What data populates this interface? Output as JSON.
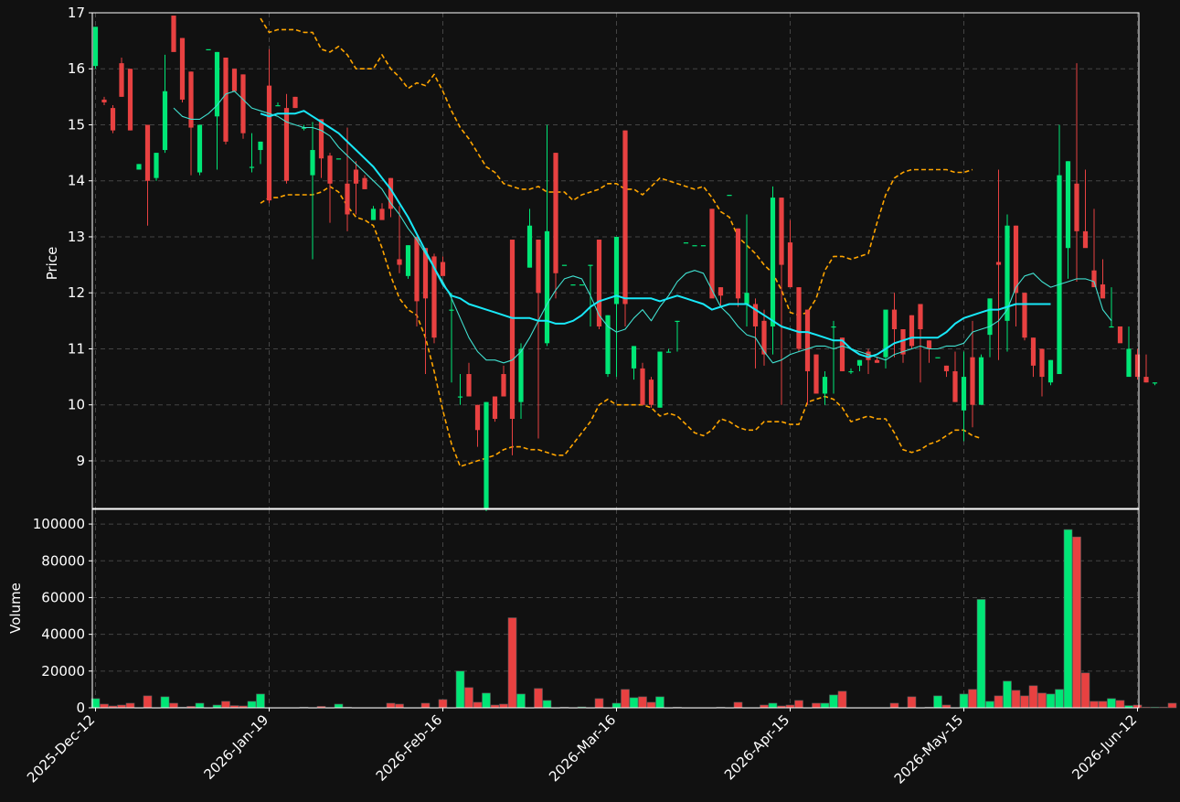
{
  "theme": {
    "background": "#111111",
    "up_color": "#00e676",
    "down_color": "#e84141",
    "ma_fast_color": "#40e0d0",
    "ma_slow_color": "#18e8f8",
    "band_color": "#ffa500",
    "grid_color": "#444444"
  },
  "chart_data": {
    "type": "candlestick",
    "price_panel": {
      "ylabel": "Price",
      "ylim": [
        8.15,
        17.0
      ],
      "yticks": [
        9,
        10,
        11,
        12,
        13,
        14,
        15,
        16,
        17
      ]
    },
    "volume_panel": {
      "ylabel": "Volume",
      "ylim": [
        0,
        108000
      ],
      "yticks": [
        0,
        20000,
        40000,
        60000,
        80000,
        100000
      ]
    },
    "x_tick_labels": [
      "2025-Dec-12",
      "2026-Jan-19",
      "2026-Feb-16",
      "2026-Mar-16",
      "2026-Apr-15",
      "2026-May-15",
      "2026-Jun-12"
    ],
    "x_tick_index": [
      0,
      20,
      40,
      60,
      80,
      100,
      120
    ],
    "grid": true,
    "series": [
      {
        "name": "ohlc",
        "o": [
          16.05,
          15.45,
          15.3,
          16.1,
          16.0,
          14.2,
          15.0,
          14.05,
          14.55,
          16.95,
          16.55,
          15.95,
          14.15,
          16.35,
          15.15,
          16.2,
          16.0,
          15.9,
          14.25,
          14.55,
          15.7,
          15.35,
          15.3,
          15.5,
          14.95,
          14.1,
          15.1,
          14.45,
          14.4,
          13.95,
          14.2,
          14.05,
          13.3,
          13.5,
          14.05,
          12.6,
          12.3,
          13.0,
          12.8,
          12.65,
          12.55,
          11.7,
          10.15,
          10.55,
          10.0,
          8.15,
          10.15,
          10.55,
          12.95,
          10.05,
          12.45,
          12.95,
          11.1,
          14.5,
          12.5,
          12.15,
          12.15,
          12.5,
          12.95,
          10.55,
          11.8,
          14.9,
          10.65,
          10.65,
          10.45,
          9.95,
          10.95,
          11.5,
          12.9,
          12.85,
          12.85,
          13.5,
          12.1,
          13.75,
          13.15,
          11.8,
          11.8,
          11.5,
          11.4,
          13.7,
          12.9,
          12.1,
          11.7,
          10.9,
          10.2,
          11.4,
          11.2,
          10.6,
          10.7,
          10.95,
          10.8,
          10.85,
          11.7,
          11.35,
          11.6,
          11.8,
          11.15,
          10.85,
          10.7,
          10.6,
          9.9,
          10.85,
          10.0,
          11.25,
          12.55,
          11.5,
          13.2,
          12.0,
          11.2,
          11.0,
          10.4,
          10.55,
          12.8,
          13.95,
          13.1,
          12.4,
          12.15,
          11.4,
          11.4,
          10.5,
          10.9,
          10.5,
          10.4
        ],
        "h": [
          16.75,
          15.5,
          15.35,
          16.2,
          16.0,
          14.3,
          15.0,
          14.5,
          16.25,
          16.95,
          16.55,
          15.95,
          15.0,
          16.35,
          16.3,
          16.2,
          16.0,
          15.9,
          14.85,
          14.7,
          16.35,
          15.4,
          15.55,
          15.5,
          15.0,
          15.05,
          15.1,
          14.5,
          14.4,
          14.95,
          14.35,
          14.1,
          13.55,
          13.6,
          14.05,
          13.55,
          12.85,
          13.0,
          12.8,
          12.7,
          12.65,
          12.0,
          10.55,
          10.75,
          10.0,
          10.05,
          10.15,
          10.7,
          12.95,
          11.1,
          13.5,
          12.95,
          15.0,
          14.5,
          12.5,
          12.15,
          12.15,
          12.5,
          12.95,
          11.6,
          13.0,
          14.9,
          11.05,
          10.75,
          10.5,
          10.95,
          11.0,
          11.5,
          12.9,
          12.85,
          12.85,
          13.5,
          12.1,
          13.75,
          13.15,
          13.4,
          11.9,
          11.7,
          13.9,
          13.7,
          13.3,
          12.1,
          11.7,
          10.9,
          10.6,
          11.5,
          11.2,
          10.65,
          10.8,
          11.0,
          10.85,
          11.25,
          12.0,
          11.35,
          11.6,
          11.8,
          11.15,
          10.85,
          10.7,
          10.95,
          10.95,
          11.5,
          10.9,
          11.45,
          14.2,
          13.4,
          13.2,
          12.0,
          11.2,
          11.0,
          10.8,
          15.0,
          14.35,
          16.1,
          14.2,
          13.5,
          12.6,
          12.1,
          11.4,
          11.4,
          11.0,
          10.9,
          10.4,
          10.55
        ],
        "l": [
          16.0,
          15.35,
          14.85,
          15.5,
          14.9,
          14.2,
          13.2,
          14.0,
          14.5,
          16.45,
          15.4,
          14.1,
          14.1,
          16.35,
          14.2,
          14.65,
          15.6,
          14.75,
          14.15,
          14.3,
          13.6,
          15.35,
          13.95,
          15.3,
          14.9,
          12.6,
          14.05,
          13.25,
          14.4,
          13.1,
          13.4,
          13.85,
          13.3,
          13.4,
          13.35,
          12.35,
          12.25,
          11.4,
          10.55,
          11.1,
          12.35,
          10.4,
          10.0,
          10.15,
          9.25,
          8.1,
          9.7,
          10.15,
          9.1,
          9.75,
          12.45,
          9.4,
          11.05,
          11.9,
          12.5,
          12.15,
          12.15,
          11.4,
          11.35,
          10.5,
          10.5,
          11.4,
          10.45,
          10.0,
          9.95,
          9.95,
          10.95,
          10.95,
          12.9,
          12.85,
          12.85,
          12.75,
          11.75,
          13.75,
          11.75,
          11.4,
          10.65,
          10.7,
          10.9,
          10.0,
          12.1,
          10.95,
          10.0,
          10.55,
          10.0,
          10.2,
          10.6,
          10.55,
          10.6,
          10.55,
          10.75,
          10.65,
          10.85,
          10.75,
          11.0,
          10.4,
          10.75,
          10.85,
          10.5,
          10.05,
          9.35,
          9.6,
          10.0,
          10.85,
          10.8,
          10.95,
          11.4,
          11.15,
          10.5,
          10.15,
          10.35,
          10.55,
          12.25,
          12.2,
          13.1,
          12.3,
          11.95,
          11.4,
          11.35,
          11.0,
          10.45,
          10.4,
          10.35,
          10.3
        ],
        "c": [
          16.75,
          15.4,
          14.9,
          15.5,
          14.9,
          14.3,
          14.0,
          14.5,
          15.6,
          16.3,
          15.45,
          14.95,
          15.0,
          16.35,
          16.3,
          14.7,
          15.6,
          14.85,
          14.25,
          14.7,
          13.65,
          15.35,
          14.0,
          15.3,
          14.95,
          14.55,
          14.4,
          13.95,
          14.4,
          13.4,
          13.95,
          13.85,
          13.5,
          13.3,
          13.5,
          12.5,
          12.85,
          11.85,
          11.9,
          11.2,
          12.3,
          11.7,
          10.15,
          10.15,
          9.55,
          10.05,
          9.75,
          10.15,
          9.75,
          11.0,
          13.2,
          12.0,
          13.1,
          12.35,
          12.5,
          12.15,
          12.15,
          12.5,
          11.4,
          11.6,
          13.0,
          11.8,
          11.05,
          10.0,
          10.0,
          10.95,
          10.95,
          11.5,
          12.9,
          12.85,
          12.85,
          11.9,
          11.95,
          13.75,
          11.9,
          12.0,
          11.4,
          10.9,
          13.7,
          12.5,
          12.1,
          11.0,
          10.6,
          10.2,
          10.5,
          11.4,
          10.6,
          10.6,
          10.8,
          10.8,
          10.75,
          11.7,
          11.35,
          10.9,
          11.05,
          11.35,
          11.0,
          10.85,
          10.6,
          10.05,
          10.5,
          10.0,
          10.85,
          11.9,
          12.5,
          13.2,
          12.0,
          11.2,
          10.7,
          10.5,
          10.8,
          14.1,
          14.35,
          13.1,
          12.8,
          12.1,
          11.9,
          11.4,
          11.1,
          11.0,
          10.5,
          10.4,
          10.4,
          10.5
        ]
      },
      {
        "name": "volume",
        "values": [
          5000,
          2000,
          1000,
          1500,
          2500,
          0,
          6500,
          0,
          6000,
          2500,
          400,
          800,
          2500,
          0,
          1500,
          3500,
          1200,
          1000,
          3500,
          7500,
          0,
          0,
          0,
          0,
          400,
          0,
          800,
          0,
          2000,
          400,
          0,
          0,
          0,
          0,
          2500,
          2000,
          0,
          0,
          2500,
          0,
          4500,
          0,
          20000,
          11000,
          3000,
          8000,
          1500,
          2000,
          49000,
          7500,
          0,
          10500,
          4000,
          0,
          400,
          0,
          500,
          0,
          5000,
          0,
          2500,
          10000,
          5500,
          6000,
          3000,
          6000,
          0,
          400,
          0,
          0,
          0,
          0,
          400,
          0,
          3000,
          0,
          0,
          1500,
          2500,
          1000,
          1500,
          4000,
          0,
          2500,
          2500,
          7000,
          9000,
          0,
          0,
          0,
          0,
          0,
          2500,
          0,
          6000,
          0,
          400,
          6500,
          1500,
          0,
          7500,
          10000,
          59000,
          3500,
          6500,
          14500,
          9500,
          6500,
          12000,
          8000,
          7500,
          10000,
          97000,
          93000,
          19000,
          3500,
          3500,
          5000,
          4000,
          1200,
          1500,
          400,
          400,
          400,
          2500
        ]
      },
      {
        "name": "ma_fast",
        "values": [
          null,
          null,
          null,
          null,
          null,
          null,
          null,
          null,
          null,
          15.3,
          15.15,
          15.1,
          15.1,
          15.2,
          15.35,
          15.55,
          15.6,
          15.45,
          15.3,
          15.25,
          15.2,
          15.15,
          15.05,
          15.0,
          14.95,
          14.95,
          14.9,
          14.8,
          14.6,
          14.45,
          14.3,
          14.15,
          14.0,
          13.85,
          13.6,
          13.4,
          13.15,
          12.95,
          12.7,
          12.45,
          12.2,
          11.9,
          11.55,
          11.2,
          10.95,
          10.8,
          10.8,
          10.75,
          10.8,
          10.95,
          11.2,
          11.5,
          11.8,
          12.05,
          12.25,
          12.3,
          12.25,
          11.95,
          11.6,
          11.4,
          11.3,
          11.35,
          11.55,
          11.7,
          11.5,
          11.75,
          11.95,
          12.2,
          12.35,
          12.4,
          12.35,
          12.05,
          11.75,
          11.6,
          11.4,
          11.25,
          11.2,
          10.95,
          10.75,
          10.8,
          10.9,
          10.95,
          11.0,
          11.05,
          11.05,
          11.0,
          11.05,
          11.0,
          10.95,
          10.9,
          10.85,
          10.8,
          10.9,
          10.95,
          11.0,
          11.05,
          11.0,
          11.0,
          11.05,
          11.05,
          11.1,
          11.3,
          11.35,
          11.4,
          11.5,
          11.7,
          12.1,
          12.3,
          12.35,
          12.2,
          12.1,
          12.15,
          12.2,
          12.25,
          12.25,
          12.2,
          11.7,
          11.5
        ]
      },
      {
        "name": "ma_slow",
        "values": [
          null,
          null,
          null,
          null,
          null,
          null,
          null,
          null,
          null,
          null,
          null,
          null,
          null,
          null,
          null,
          null,
          null,
          null,
          null,
          15.2,
          15.15,
          15.2,
          15.2,
          15.2,
          15.25,
          15.15,
          15.05,
          14.95,
          14.85,
          14.7,
          14.55,
          14.4,
          14.25,
          14.05,
          13.85,
          13.6,
          13.35,
          13.05,
          12.75,
          12.45,
          12.15,
          11.95,
          11.9,
          11.8,
          11.75,
          11.7,
          11.65,
          11.6,
          11.55,
          11.55,
          11.55,
          11.5,
          11.5,
          11.45,
          11.45,
          11.5,
          11.6,
          11.75,
          11.85,
          11.9,
          11.95,
          11.9,
          11.9,
          11.9,
          11.9,
          11.85,
          11.9,
          11.95,
          11.9,
          11.85,
          11.8,
          11.7,
          11.75,
          11.8,
          11.8,
          11.8,
          11.7,
          11.6,
          11.5,
          11.4,
          11.35,
          11.3,
          11.3,
          11.25,
          11.2,
          11.15,
          11.15,
          11.0,
          10.9,
          10.85,
          10.9,
          11.0,
          11.1,
          11.15,
          11.2,
          11.2,
          11.2,
          11.2,
          11.3,
          11.45,
          11.55,
          11.6,
          11.65,
          11.7,
          11.7,
          11.75,
          11.8,
          11.8,
          11.8,
          11.8,
          11.8
        ]
      },
      {
        "name": "band_upper",
        "values": [
          null,
          null,
          null,
          null,
          null,
          null,
          null,
          null,
          null,
          null,
          null,
          null,
          null,
          null,
          null,
          null,
          null,
          null,
          null,
          16.9,
          16.65,
          16.7,
          16.7,
          16.7,
          16.65,
          16.65,
          16.35,
          16.3,
          16.4,
          16.25,
          16.0,
          16.0,
          16.0,
          16.25,
          16.0,
          15.85,
          15.65,
          15.75,
          15.7,
          15.9,
          15.6,
          15.25,
          14.95,
          14.75,
          14.5,
          14.25,
          14.15,
          13.95,
          13.9,
          13.85,
          13.85,
          13.9,
          13.8,
          13.8,
          13.8,
          13.65,
          13.75,
          13.8,
          13.85,
          13.95,
          13.95,
          13.85,
          13.85,
          13.75,
          13.9,
          14.05,
          14.0,
          13.95,
          13.9,
          13.85,
          13.9,
          13.7,
          13.45,
          13.35,
          13.0,
          12.85,
          12.7,
          12.5,
          12.35,
          12.05,
          11.65,
          11.6,
          11.65,
          11.9,
          12.4,
          12.65,
          12.65,
          12.6,
          12.65,
          12.7,
          13.25,
          13.75,
          14.05,
          14.15,
          14.2,
          14.2,
          14.2,
          14.2,
          14.2,
          14.15,
          14.15,
          14.2
        ]
      },
      {
        "name": "band_lower",
        "values": [
          null,
          null,
          null,
          null,
          null,
          null,
          null,
          null,
          null,
          null,
          null,
          null,
          null,
          null,
          null,
          null,
          null,
          null,
          null,
          13.6,
          13.7,
          13.7,
          13.75,
          13.75,
          13.75,
          13.75,
          13.8,
          13.9,
          13.8,
          13.55,
          13.35,
          13.3,
          13.2,
          12.8,
          12.3,
          11.9,
          11.7,
          11.6,
          11.2,
          10.6,
          9.9,
          9.3,
          8.9,
          8.95,
          9.0,
          9.05,
          9.1,
          9.2,
          9.25,
          9.25,
          9.2,
          9.2,
          9.15,
          9.1,
          9.1,
          9.3,
          9.5,
          9.7,
          10.0,
          10.1,
          10.0,
          10.0,
          10.0,
          10.0,
          9.95,
          9.8,
          9.85,
          9.8,
          9.65,
          9.5,
          9.45,
          9.55,
          9.75,
          9.7,
          9.6,
          9.55,
          9.55,
          9.7,
          9.7,
          9.7,
          9.65,
          9.65,
          10.05,
          10.1,
          10.15,
          10.1,
          9.95,
          9.7,
          9.75,
          9.8,
          9.75,
          9.75,
          9.5,
          9.2,
          9.15,
          9.2,
          9.3,
          9.35,
          9.45,
          9.55,
          9.55,
          9.45,
          9.4
        ]
      }
    ]
  }
}
